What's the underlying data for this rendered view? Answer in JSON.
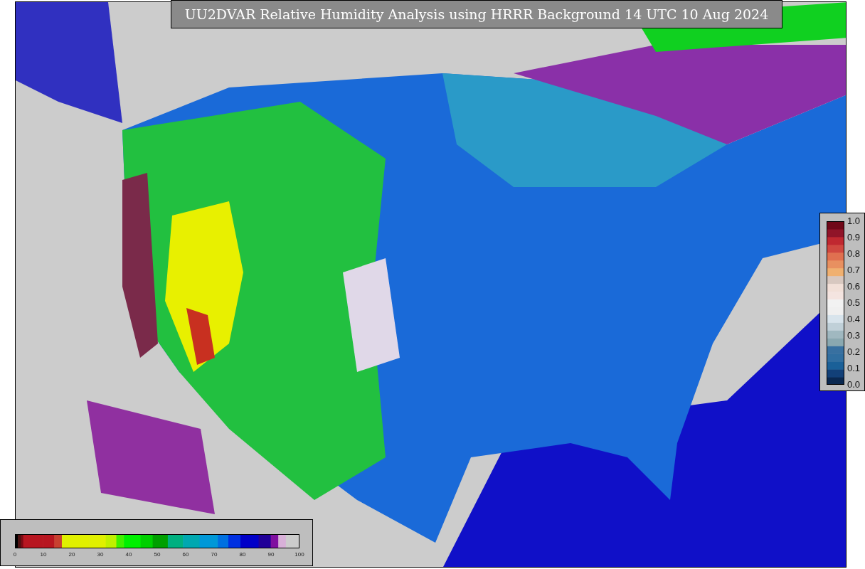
{
  "title": "UU2DVAR Relative Humidity Analysis using HRRR Background 14 UTC 10 Aug 2024",
  "horizontal_colorbar": {
    "ticks": [
      "0",
      "10",
      "20",
      "30",
      "40",
      "50",
      "60",
      "70",
      "80",
      "90",
      "100"
    ]
  },
  "vertical_colorbar": {
    "ticks": [
      "1.0",
      "0.9",
      "0.8",
      "0.7",
      "0.6",
      "0.5",
      "0.4",
      "0.3",
      "0.2",
      "0.1",
      "0.0"
    ]
  }
}
